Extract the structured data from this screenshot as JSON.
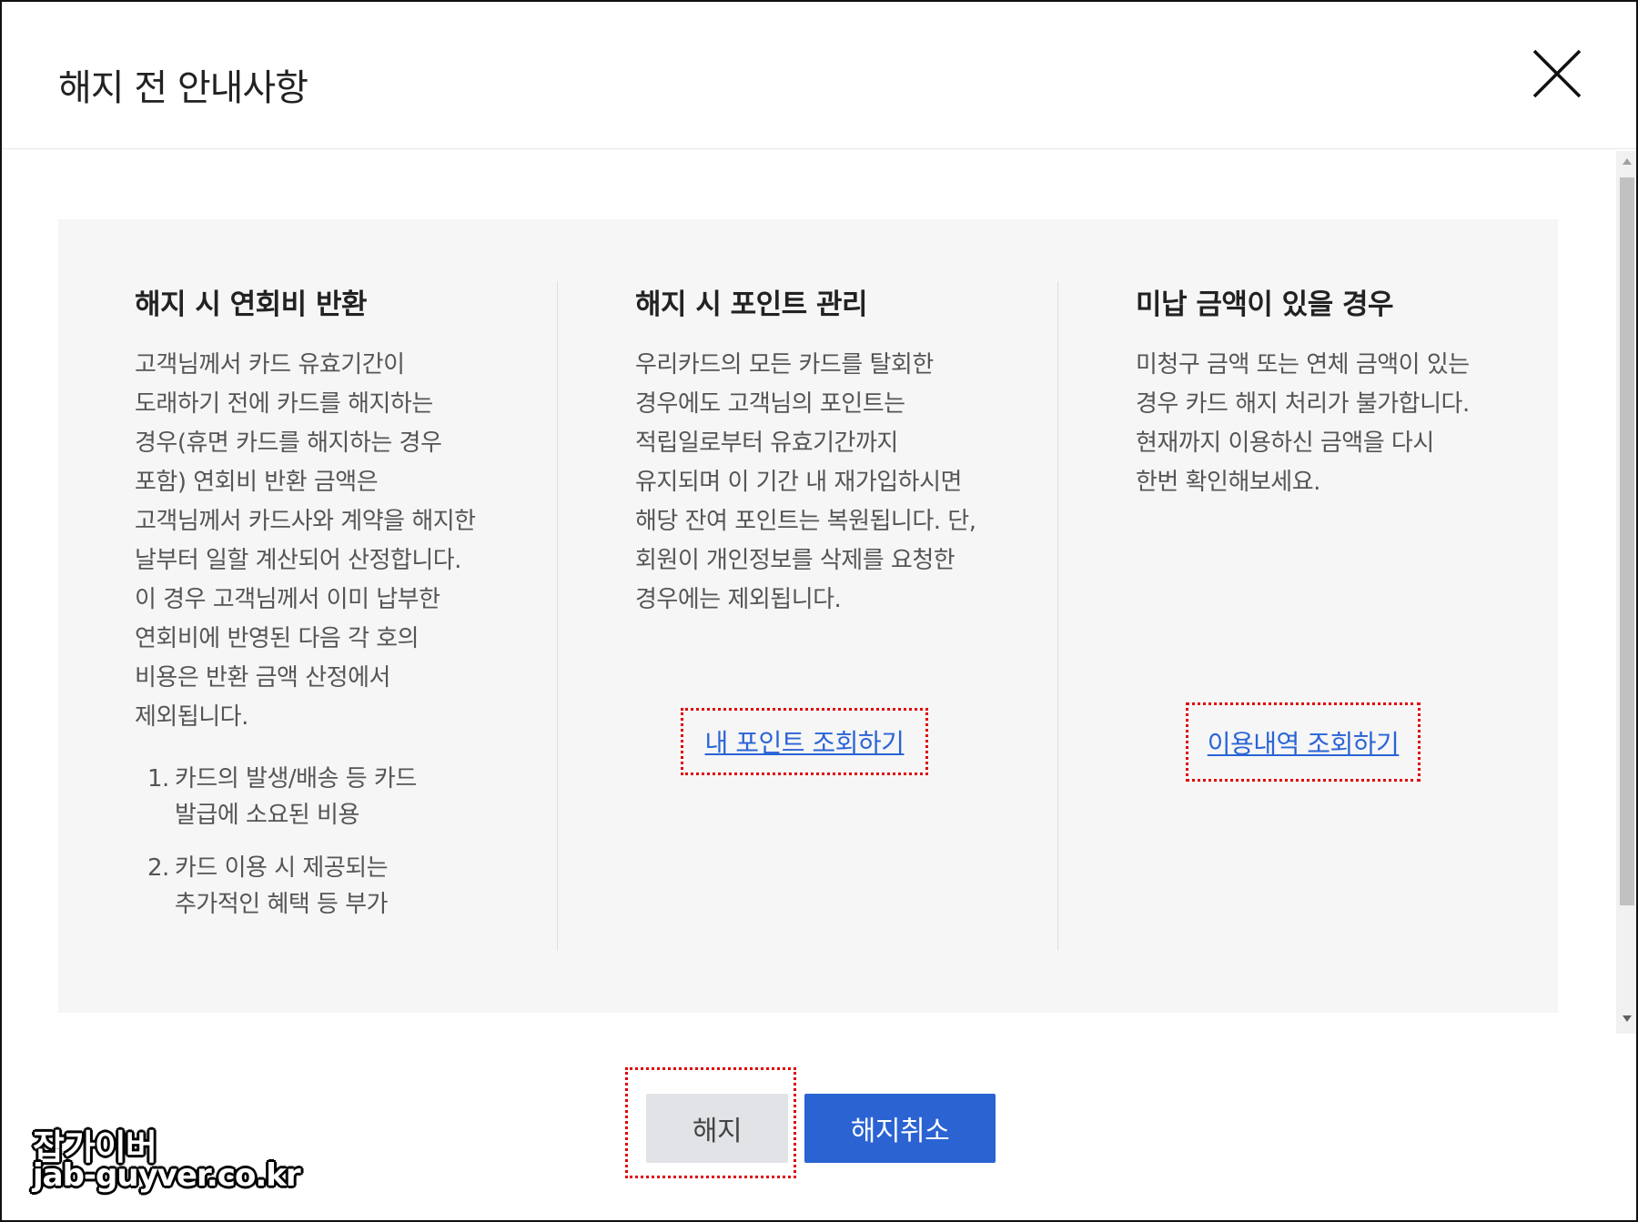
{
  "dialog": {
    "title": "해지 전 안내사항",
    "close_icon": "close-icon"
  },
  "sections": [
    {
      "heading": "해지 시 연회비 반환",
      "body": "고객님께서 카드 유효기간이\n도래하기 전에 카드를 해지하는\n경우(휴면 카드를 해지하는 경우\n포함) 연회비 반환 금액은\n고객님께서 카드사와 계약을 해지한\n날부터 일할 계산되어 산정합니다.\n이 경우 고객님께서 이미 납부한\n연회비에 반영된 다음 각 호의\n비용은 반환 금액 산정에서\n제외됩니다.",
      "list": [
        {
          "num": "1.",
          "text": "카드의 발생/배송 등 카드\n발급에 소요된 비용"
        },
        {
          "num": "2.",
          "text": "카드 이용 시 제공되는\n추가적인 혜택 등 부가"
        }
      ]
    },
    {
      "heading": "해지 시 포인트 관리",
      "body": "우리카드의 모든 카드를 탈회한\n경우에도 고객님의 포인트는\n적립일로부터 유효기간까지\n유지되며 이 기간 내 재가입하시면\n해당 잔여 포인트는 복원됩니다. 단,\n회원이 개인정보를 삭제를 요청한\n경우에는 제외됩니다.",
      "link": "내 포인트 조회하기"
    },
    {
      "heading": "미납 금액이 있을 경우",
      "body": "미청구 금액 또는 연체 금액이 있는\n경우 카드 해지 처리가 불가합니다.\n현재까지 이용하신 금액을 다시\n한번 확인해보세요.",
      "link": "이용내역 조회하기"
    }
  ],
  "buttons": {
    "terminate": "해지",
    "cancel_termination": "해지취소"
  },
  "watermark": {
    "line1": "잡가이버",
    "line2": "jab-guyver.co.kr"
  },
  "colors": {
    "primary_button": "#2b63d2",
    "secondary_button": "#e1e3e6",
    "link": "#2a64d6",
    "highlight_dotted_border": "#e00000",
    "panel_background": "#f6f6f6"
  }
}
